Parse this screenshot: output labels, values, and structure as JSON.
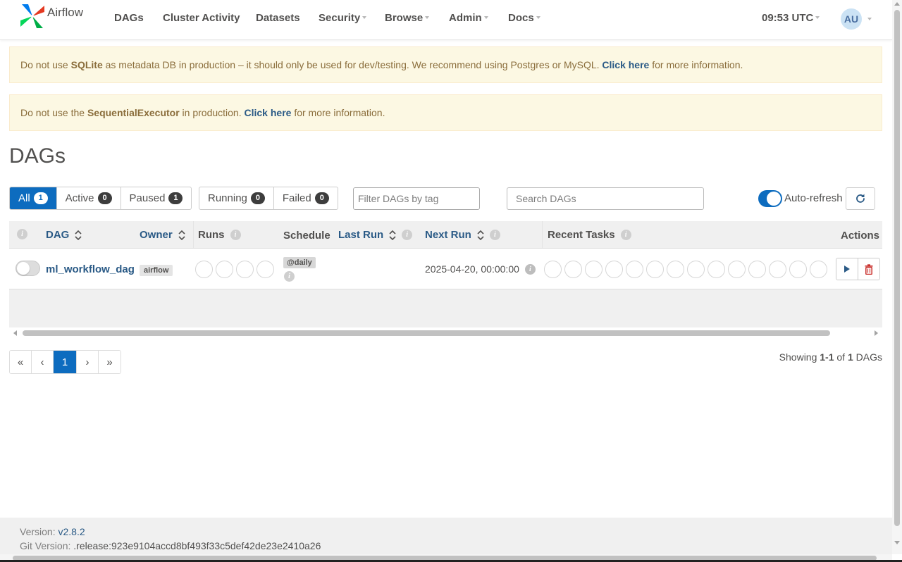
{
  "brand": {
    "name": "Airflow"
  },
  "nav": {
    "dags": "DAGs",
    "cluster_activity": "Cluster Activity",
    "datasets": "Datasets",
    "security": "Security",
    "browse": "Browse",
    "admin": "Admin",
    "docs": "Docs",
    "time": "09:53 UTC",
    "user_initials": "AU"
  },
  "alerts": {
    "sqlite": {
      "pre": "Do not use ",
      "strong": "SQLite",
      "mid": " as metadata DB in production – it should only be used for dev/testing. We recommend using Postgres or MySQL. ",
      "link": "Click here",
      "post": " for more information."
    },
    "executor": {
      "pre": "Do not use the ",
      "strong": "SequentialExecutor",
      "mid": " in production. ",
      "link": "Click here",
      "post": " for more information."
    }
  },
  "page": {
    "title": "DAGs"
  },
  "filters": {
    "all": {
      "label": "All",
      "count": "1"
    },
    "active": {
      "label": "Active",
      "count": "0"
    },
    "paused": {
      "label": "Paused",
      "count": "1"
    },
    "running": {
      "label": "Running",
      "count": "0"
    },
    "failed": {
      "label": "Failed",
      "count": "0"
    },
    "tag_placeholder": "Filter DAGs by tag",
    "search_placeholder": "Search DAGs",
    "auto_refresh": "Auto-refresh"
  },
  "table": {
    "headers": {
      "dag": "DAG",
      "owner": "Owner",
      "runs": "Runs",
      "schedule": "Schedule",
      "last_run": "Last Run",
      "next_run": "Next Run",
      "recent_tasks": "Recent Tasks",
      "actions": "Actions"
    },
    "rows": [
      {
        "dag_id": "ml_workflow_dag",
        "owner": "airflow",
        "schedule": "@daily",
        "last_run": "",
        "next_run": "2025-04-20, 00:00:00"
      }
    ]
  },
  "pagination": {
    "first": "«",
    "prev": "‹",
    "current": "1",
    "next": "›",
    "last": "»",
    "showing_pre": "Showing ",
    "range": "1-1",
    "of": " of ",
    "total": "1",
    "suffix": " DAGs"
  },
  "footer": {
    "version_label": "Version: ",
    "version": "v2.8.2",
    "git_label": "Git Version: ",
    "git": ".release:923e9104accd8bf493f33c5def42de23e2410a26"
  },
  "colors": {
    "primary": "#0d6cbf",
    "link": "#2a5a86",
    "alert_bg": "#fcf8e3",
    "alert_text": "#8a6d3b",
    "delete": "#c9302c"
  }
}
